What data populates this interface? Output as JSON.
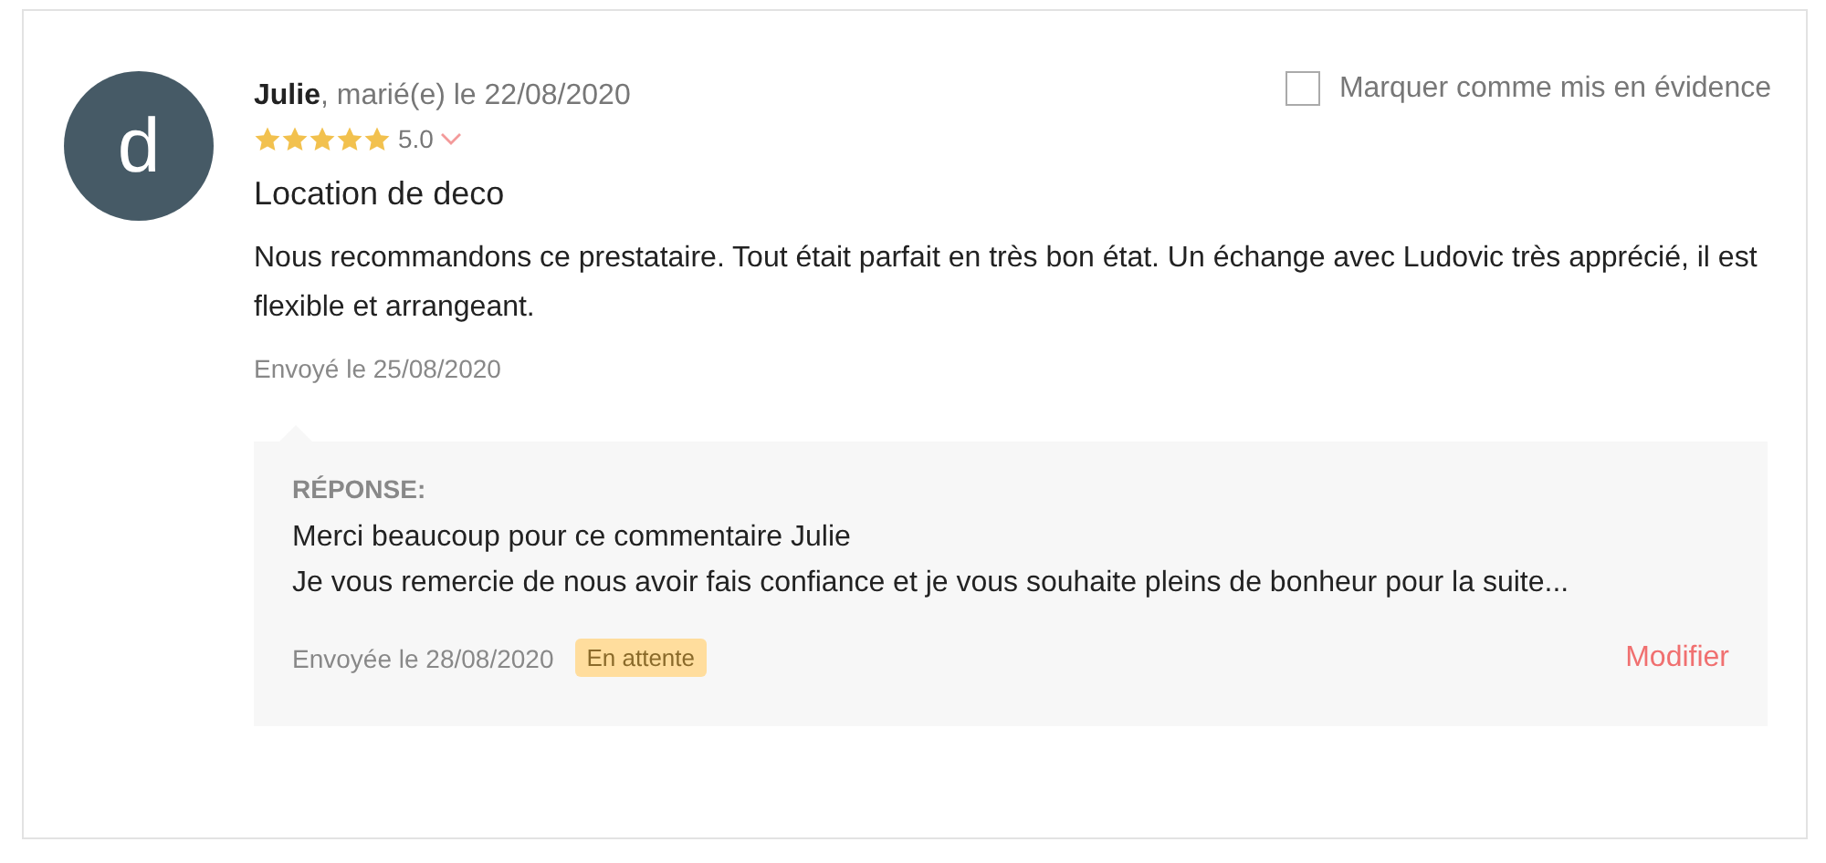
{
  "review": {
    "avatar_letter": "d",
    "author": "Julie",
    "subtitle": ", marié(e) le 22/08/2020",
    "stars": 5,
    "rating": "5.0",
    "highlight": {
      "label": "Marquer comme mis en évidence",
      "checked": false
    },
    "title": "Location de deco",
    "body": "Nous recommandons ce prestataire. Tout était parfait en très bon état. Un échange avec Ludovic très apprécié, il est flexible et arrangeant.",
    "sent": "Envoyé le 25/08/2020"
  },
  "response": {
    "heading": "RÉPONSE:",
    "lines": [
      "Merci beaucoup pour ce commentaire Julie",
      "Je vous remercie de nous avoir fais confiance et je vous souhaite pleins de bonheur pour la suite..."
    ],
    "sent": "Envoyée le 28/08/2020",
    "status": "En attente",
    "action": "Modifier"
  }
}
